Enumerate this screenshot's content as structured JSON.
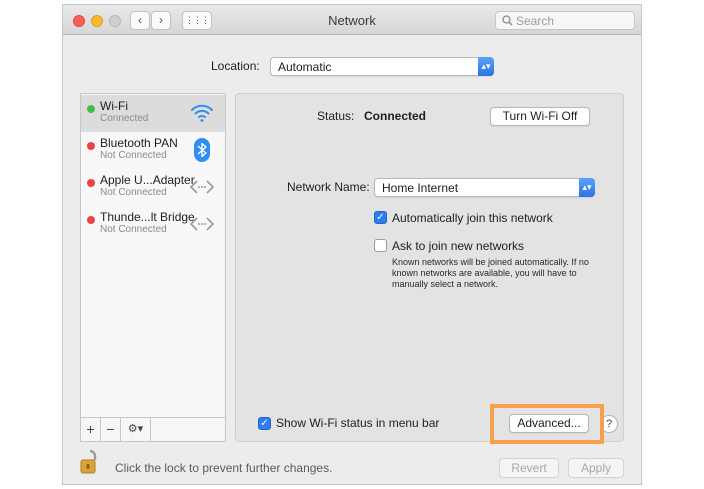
{
  "window": {
    "title": "Network",
    "search_placeholder": "Search",
    "nav_back": "‹",
    "nav_forward": "›",
    "grid_icon": "⋮⋮⋮"
  },
  "location": {
    "label": "Location:",
    "value": "Automatic"
  },
  "services": [
    {
      "name": "Wi-Fi",
      "status": "Connected",
      "dot_color": "#3cbf4a",
      "icon": "wifi-icon"
    },
    {
      "name": "Bluetooth PAN",
      "status": "Not Connected",
      "dot_color": "#e64545",
      "icon": "bluetooth-icon"
    },
    {
      "name": "Apple U...Adapter",
      "status": "Not Connected",
      "dot_color": "#e64545",
      "icon": "ethernet-icon"
    },
    {
      "name": "Thunde...lt Bridge",
      "status": "Not Connected",
      "dot_color": "#e64545",
      "icon": "ethernet-icon"
    }
  ],
  "sidebar_toolbar": {
    "add": "+",
    "remove": "−",
    "gear": "⚙▾"
  },
  "detail": {
    "status_label": "Status:",
    "status_value": "Connected",
    "toggle_wifi_button": "Turn Wi-Fi Off",
    "network_name_label": "Network Name:",
    "network_name_value": "Home Internet",
    "auto_join_label": "Automatically join this network",
    "auto_join_checked": true,
    "ask_join_label": "Ask to join new networks",
    "ask_join_checked": false,
    "ask_join_note": "Known networks will be joined automatically. If no known networks are available, you will have to manually select a network.",
    "show_status_label": "Show Wi-Fi status in menu bar",
    "show_status_checked": true,
    "advanced_button": "Advanced...",
    "help_button": "?"
  },
  "footer": {
    "lock_text": "Click the lock to prevent further changes.",
    "revert_button": "Revert",
    "apply_button": "Apply"
  },
  "colors": {
    "accent": "#2e7cf6",
    "highlight": "#f5a04a",
    "connected": "#3cbf4a",
    "disconnected": "#e64545"
  }
}
